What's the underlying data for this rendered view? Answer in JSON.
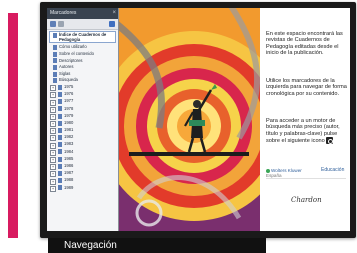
{
  "panel": {
    "title": "Marcadores",
    "close_glyph": "×"
  },
  "tree": {
    "top_items": [
      {
        "label": "Índice de Cuadernos de Pedagogía",
        "selected": true
      },
      {
        "label": "Cómo utilizarlo"
      },
      {
        "label": "Sobre el contenido"
      },
      {
        "label": "Descriptores"
      },
      {
        "label": "Autores"
      },
      {
        "label": "Siglas"
      },
      {
        "label": "Búsqueda"
      }
    ],
    "years": [
      "1975",
      "1976",
      "1977",
      "1978",
      "1979",
      "1980",
      "1981",
      "1982",
      "1983",
      "1984",
      "1985",
      "1986",
      "1987",
      "1988",
      "1989"
    ]
  },
  "info": {
    "para1": "En este espacio encontrará las revistas de Cuadernos de Pedagogía editadas desde el inicio de la publicación.",
    "para2": "Utilice los marcadores de la izquierda para navegar de forma cronológica por su contenido.",
    "para3": "Para acceder a un motor de búsqueda más preciso (autor, título y palabras-clave) pulse sobre el siguiente icono",
    "logo_wk": "Wolters Kluwer",
    "logo_wk_sub": "España",
    "logo_ed": "Educación",
    "logo_ch": "Chardon"
  },
  "caption": "Navegación",
  "colors": {
    "accent": "#d81b60",
    "panel_header": "#394350",
    "art_orange": "#e4542e"
  }
}
